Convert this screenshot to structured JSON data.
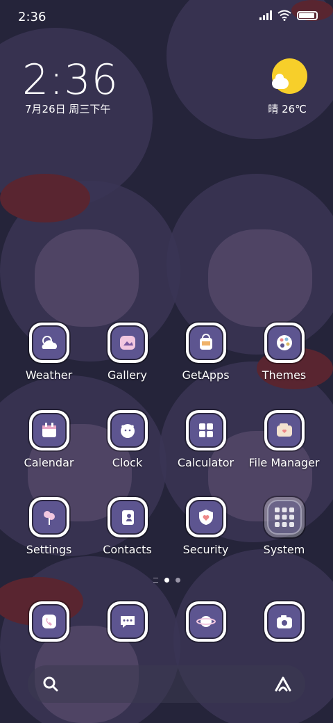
{
  "status_bar": {
    "time": "2:36"
  },
  "widget": {
    "clock": "2:36",
    "date": "7月26日 周三下午",
    "weather": "晴 26℃",
    "sun_color": "#f7cf2a"
  },
  "apps": [
    {
      "label": "Weather",
      "icon": "weather-icon"
    },
    {
      "label": "Gallery",
      "icon": "gallery-icon"
    },
    {
      "label": "GetApps",
      "icon": "getapps-icon"
    },
    {
      "label": "Themes",
      "icon": "themes-icon"
    },
    {
      "label": "Calendar",
      "icon": "calendar-icon"
    },
    {
      "label": "Clock",
      "icon": "clock-icon"
    },
    {
      "label": "Calculator",
      "icon": "calculator-icon"
    },
    {
      "label": "File Manager",
      "icon": "file-manager-icon"
    },
    {
      "label": "Settings",
      "icon": "settings-icon"
    },
    {
      "label": "Contacts",
      "icon": "contacts-icon"
    },
    {
      "label": "Security",
      "icon": "security-icon"
    },
    {
      "label": "System",
      "icon": "system-folder-icon"
    }
  ],
  "dock": [
    {
      "icon": "phone-icon"
    },
    {
      "icon": "messages-icon"
    },
    {
      "icon": "browser-icon"
    },
    {
      "icon": "camera-icon"
    }
  ],
  "colors": {
    "icon_fill": "#5d5590",
    "icon_border": "#ffffff",
    "accent": "#f7cf2a"
  }
}
